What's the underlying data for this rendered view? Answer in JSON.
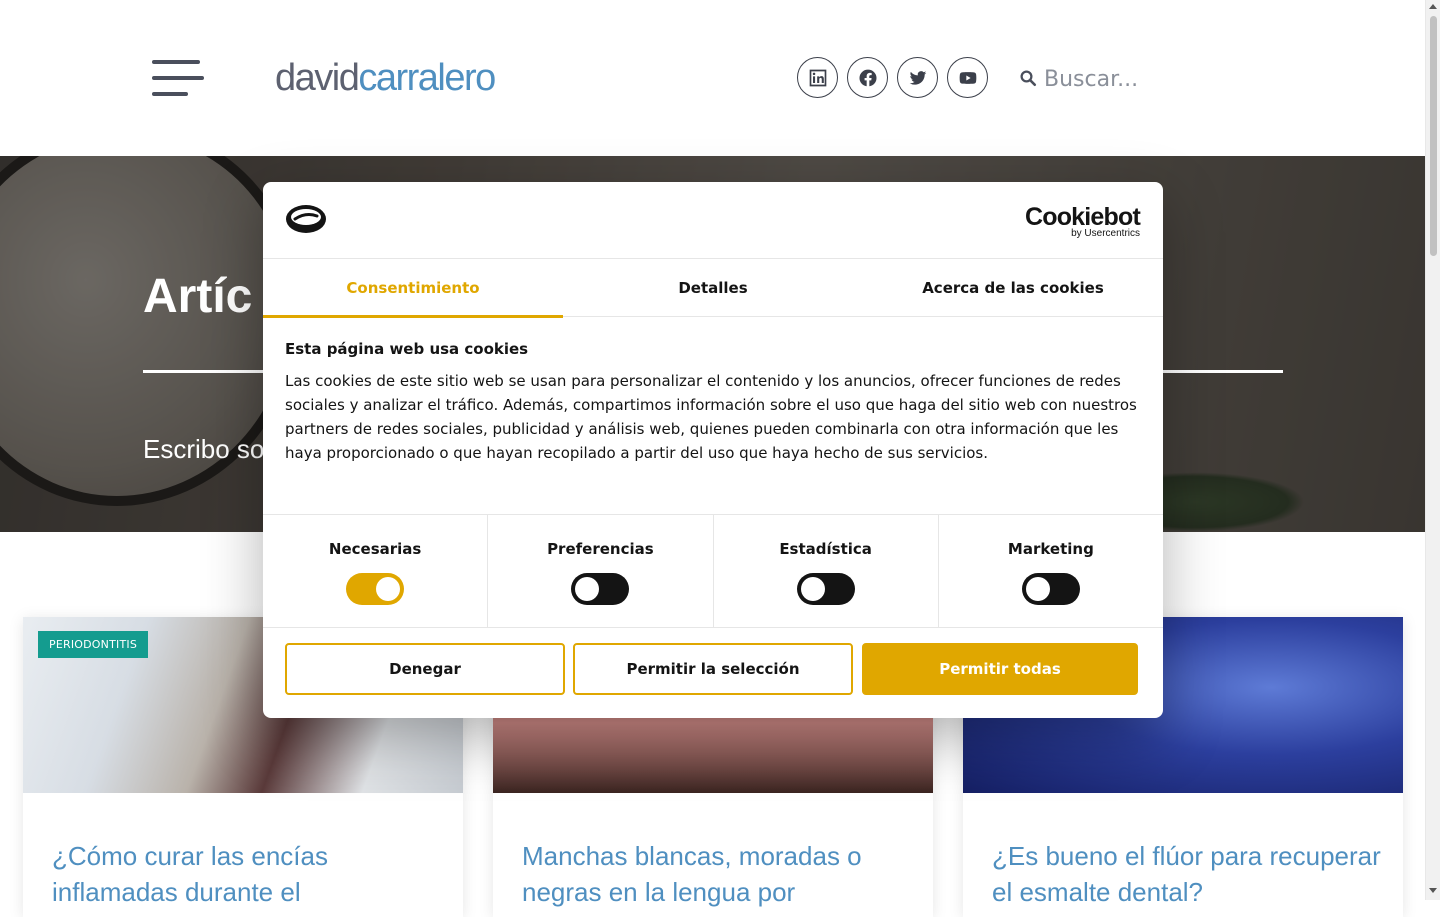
{
  "header": {
    "logo_part1": "david",
    "logo_part2": "carralero",
    "menu_icon": "hamburger-menu-icon",
    "social": [
      {
        "name": "linkedin",
        "icon": "linkedin-icon"
      },
      {
        "name": "facebook",
        "icon": "facebook-icon"
      },
      {
        "name": "twitter",
        "icon": "twitter-icon"
      },
      {
        "name": "youtube",
        "icon": "youtube-icon"
      }
    ],
    "search": {
      "placeholder": "Buscar...",
      "icon": "search-icon"
    }
  },
  "hero": {
    "title": "Artíc",
    "subtitle": "Escribo so"
  },
  "cards": [
    {
      "badge": "Periodontitis",
      "title": "¿Cómo curar las encías inflamadas durante el"
    },
    {
      "badge": "",
      "title": "Manchas blancas, moradas o negras en la lengua por"
    },
    {
      "badge": "",
      "title": "¿Es bueno el flúor para recuperar el esmalte dental?"
    }
  ],
  "cookie_dialog": {
    "brand": {
      "word": "Cookiebot",
      "by": "by Usercentrics"
    },
    "tabs": [
      {
        "label": "Consentimiento",
        "active": true
      },
      {
        "label": "Detalles",
        "active": false
      },
      {
        "label": "Acerca de las cookies",
        "active": false
      }
    ],
    "heading": "Esta página web usa cookies",
    "body": "Las cookies de este sitio web se usan para personalizar el contenido y los anuncios, ofrecer funciones de redes sociales y analizar el tráfico. Además, compartimos información sobre el uso que haga del sitio web con nuestros partners de redes sociales, publicidad y análisis web, quienes pueden combinarla con otra información que les haya proporcionado o que hayan recopilado a partir del uso que haya hecho de sus servicios.",
    "toggles": [
      {
        "label": "Necesarias",
        "on": true
      },
      {
        "label": "Preferencias",
        "on": false
      },
      {
        "label": "Estadística",
        "on": false
      },
      {
        "label": "Marketing",
        "on": false
      }
    ],
    "buttons": {
      "deny": "Denegar",
      "allow_selection": "Permitir la selección",
      "allow_all": "Permitir todas"
    }
  },
  "colors": {
    "accent": "#e0a700",
    "link_blue": "#4f8fc0",
    "badge_teal": "#149c8f",
    "text_dark": "#141414"
  }
}
